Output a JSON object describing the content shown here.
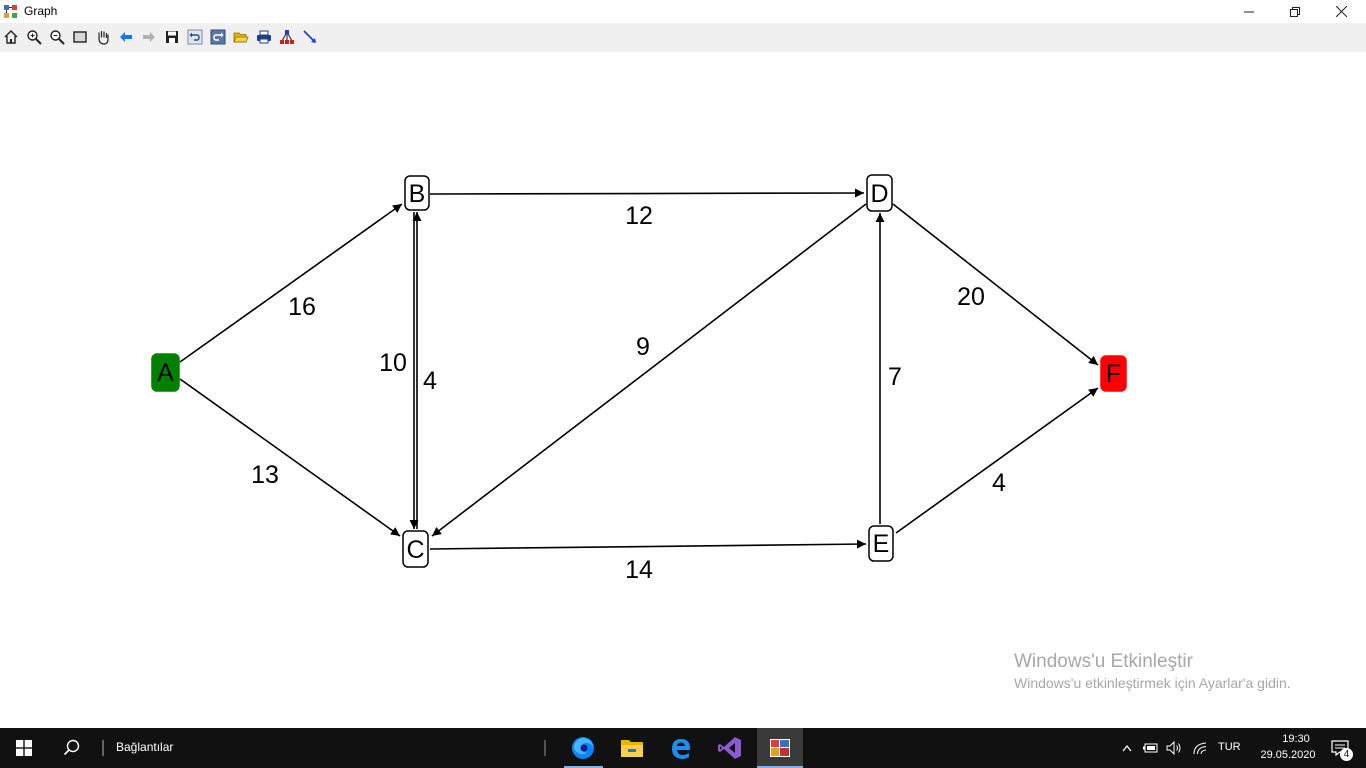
{
  "window": {
    "title": "Graph"
  },
  "toolbar": {
    "buttons": [
      "home-icon",
      "zoom-in-icon",
      "zoom-out-icon",
      "window-zoom-icon",
      "pan-hand-icon",
      "back-arrow-icon",
      "forward-arrow-icon",
      "save-icon",
      "undo-icon",
      "redo-icon",
      "open-folder-icon",
      "print-icon",
      "layout-icon",
      "edge-icon"
    ]
  },
  "graph": {
    "nodes": [
      {
        "id": "A",
        "label": "A",
        "fill": "#008000"
      },
      {
        "id": "B",
        "label": "B",
        "fill": "#ffffff"
      },
      {
        "id": "C",
        "label": "C",
        "fill": "#ffffff"
      },
      {
        "id": "D",
        "label": "D",
        "fill": "#ffffff"
      },
      {
        "id": "E",
        "label": "E",
        "fill": "#ffffff"
      },
      {
        "id": "F",
        "label": "F",
        "fill": "#ff0000"
      }
    ],
    "edges": [
      {
        "from": "A",
        "to": "B",
        "weight": "16"
      },
      {
        "from": "A",
        "to": "C",
        "weight": "13"
      },
      {
        "from": "C",
        "to": "B",
        "weight": "4"
      },
      {
        "from": "B",
        "to": "C",
        "weight": "10"
      },
      {
        "from": "B",
        "to": "D",
        "weight": "12"
      },
      {
        "from": "D",
        "to": "C",
        "weight": "9"
      },
      {
        "from": "C",
        "to": "E",
        "weight": "14"
      },
      {
        "from": "E",
        "to": "D",
        "weight": "7"
      },
      {
        "from": "D",
        "to": "F",
        "weight": "20"
      },
      {
        "from": "E",
        "to": "F",
        "weight": "4"
      }
    ]
  },
  "watermark": {
    "line1": "Windows'u Etkinleştir",
    "line2": "Windows'u etkinleştirmek için Ayarlar'a gidin."
  },
  "taskbar": {
    "search_label": "Bağlantılar",
    "language": "TUR",
    "time": "19:30",
    "date": "29.05.2020",
    "notification_count": "4"
  }
}
